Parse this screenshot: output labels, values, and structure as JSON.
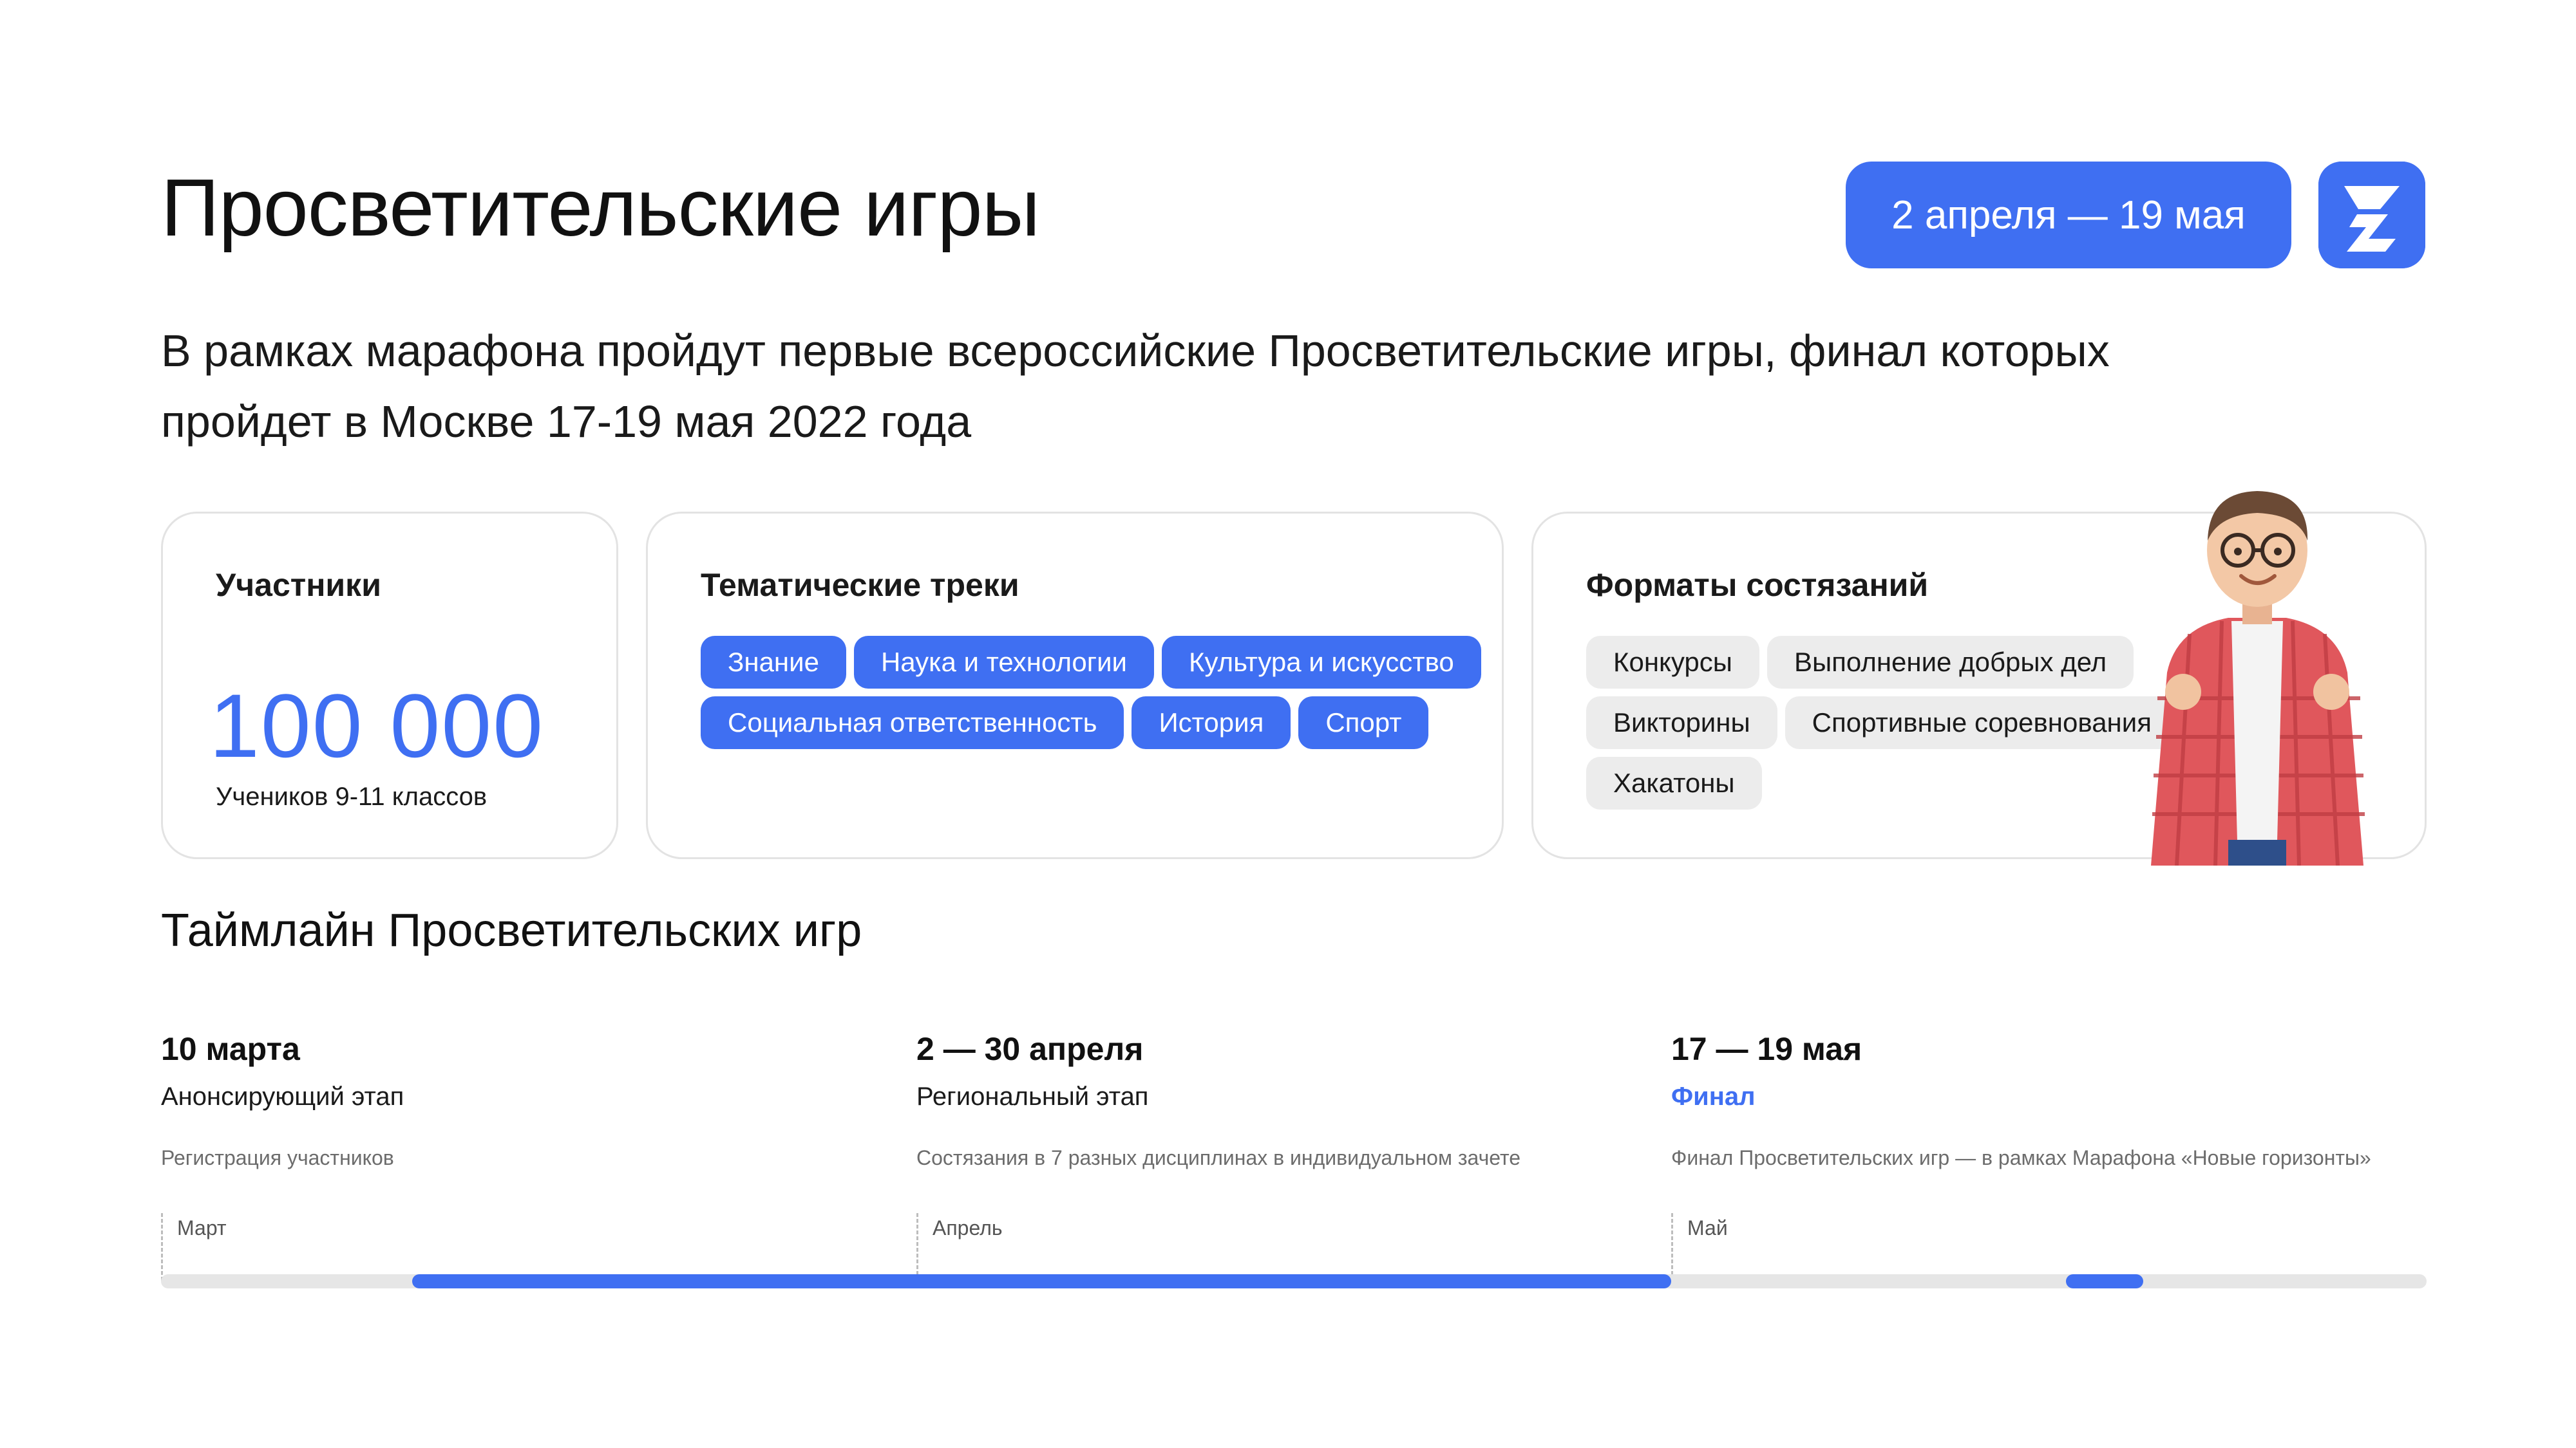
{
  "header": {
    "title": "Просветительские игры",
    "date_range": "2 апреля — 19 мая",
    "logo_icon": "z-logo-icon"
  },
  "lead": "В рамках марафона пройдут первые всероссийские Просветительские игры, финал которых пройдет в Москве 17-19 мая 2022 года",
  "cards": {
    "participants": {
      "title": "Участники",
      "value": "100 000",
      "caption": "Учеников 9-11 классов"
    },
    "tracks": {
      "title": "Тематические треки",
      "tags": [
        "Знание",
        "Наука и технологии",
        "Культура и искусство",
        "Социальная ответственность",
        "История",
        "Спорт"
      ]
    },
    "formats": {
      "title": "Форматы состязаний",
      "tags": [
        "Конкурсы",
        "Выполнение добрых дел",
        "Викторины",
        "Спортивные соревнования",
        "Хакатоны"
      ]
    }
  },
  "timeline": {
    "title": "Таймлайн Просветительских игр",
    "stages": [
      {
        "date": "10 марта",
        "name": "Анонсирующий этап",
        "description": "Регистрация участников"
      },
      {
        "date": "2 — 30 апреля",
        "name": "Региональный этап",
        "description": "Состязания в 7 разных дисциплинах в индивидуальном зачете"
      },
      {
        "date": "17 — 19 мая",
        "name": "Финал",
        "description": "Финал Просветительских игр — в рамках Марафона «Новые горизонты»"
      }
    ],
    "months": [
      "Март",
      "Апрель",
      "Май"
    ]
  },
  "colors": {
    "accent": "#3f6ff2",
    "tag_grey": "#ececec",
    "track_grey": "#e6e6e6"
  }
}
